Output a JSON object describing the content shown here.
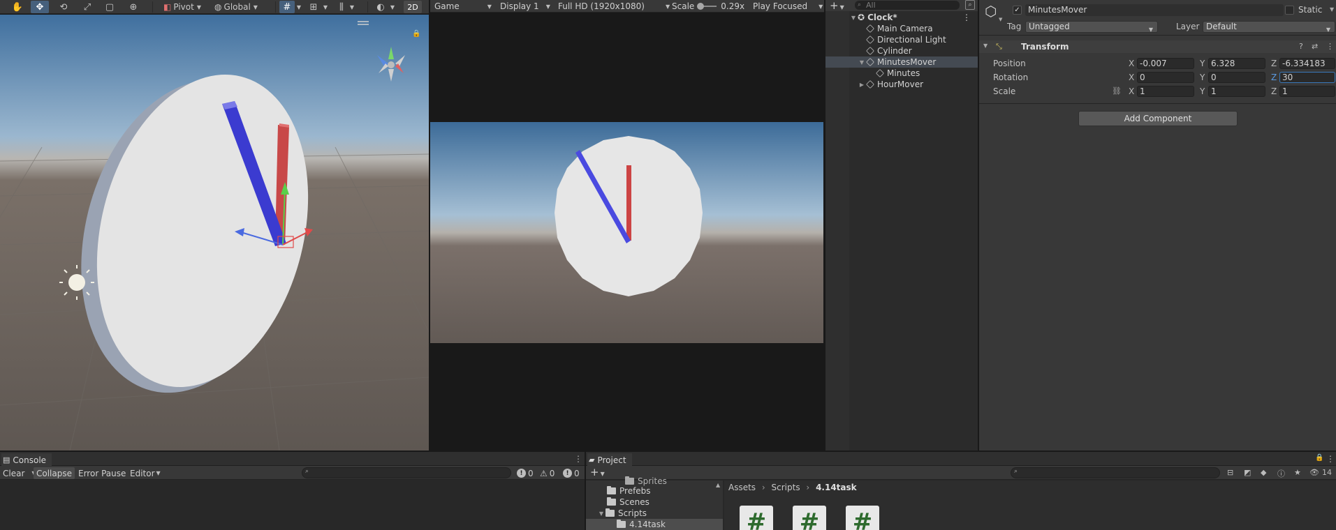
{
  "scene_toolbar": {
    "pivot": "Pivot",
    "global": "Global",
    "mode_2d": "2D"
  },
  "game_toolbar": {
    "view": "Game",
    "display": "Display 1",
    "resolution": "Full HD (1920x1080)",
    "scale_label": "Scale",
    "scale_value": "0.29x",
    "play_mode": "Play Focused"
  },
  "hierarchy": {
    "search_placeholder": "All",
    "items": [
      {
        "label": "Clock*"
      },
      {
        "label": "Main Camera"
      },
      {
        "label": "Directional Light"
      },
      {
        "label": "Cylinder"
      },
      {
        "label": "MinutesMover"
      },
      {
        "label": "Minutes"
      },
      {
        "label": "HourMover"
      }
    ]
  },
  "inspector": {
    "object_name": "MinutesMover",
    "static_label": "Static",
    "tag_label": "Tag",
    "tag_value": "Untagged",
    "layer_label": "Layer",
    "layer_value": "Default",
    "component": "Transform",
    "position_label": "Position",
    "rotation_label": "Rotation",
    "scale_label": "Scale",
    "axis_x": "X",
    "axis_y": "Y",
    "axis_z": "Z",
    "position": {
      "x": "-0.007",
      "y": "6.328",
      "z": "-6.334183"
    },
    "rotation": {
      "x": "0",
      "y": "0",
      "z": "30"
    },
    "scale": {
      "x": "1",
      "y": "1",
      "z": "1"
    },
    "add_component": "Add Component"
  },
  "console": {
    "tab": "Console",
    "clear": "Clear",
    "collapse": "Collapse",
    "error_pause": "Error Pause",
    "editor": "Editor",
    "log_count": "0",
    "warning_count": "0",
    "error_count": "0"
  },
  "project": {
    "tab": "Project",
    "hidden_count": "14",
    "tree": [
      {
        "label": "Sprites"
      },
      {
        "label": "Prefebs"
      },
      {
        "label": "Scenes"
      },
      {
        "label": "Scripts"
      },
      {
        "label": "4.14task"
      }
    ],
    "breadcrumb": [
      "Assets",
      "Scripts",
      "4.14task"
    ],
    "script_glyph": "#"
  },
  "colors": {
    "selection": "#444a52",
    "minute_hand": "#4b4bdc",
    "hour_hand": "#d85050",
    "clock_face": "#e6e6e6"
  }
}
